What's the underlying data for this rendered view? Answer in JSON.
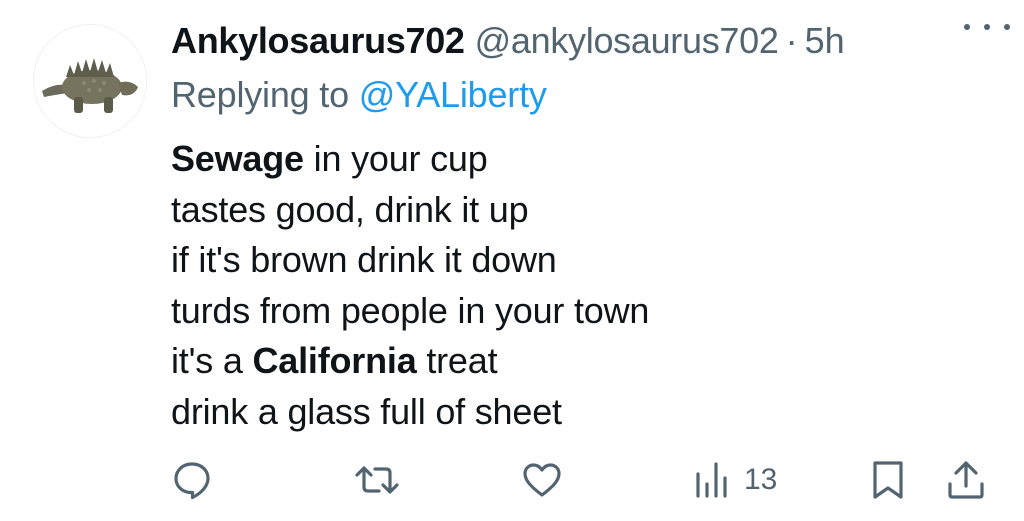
{
  "author": {
    "display_name": "Ankylosaurus702",
    "handle": "@ankylosaurus702",
    "separator": "·",
    "time": "5h"
  },
  "reply": {
    "prefix": "Replying to ",
    "mention": "@YALiberty"
  },
  "body": {
    "l1_bold": "Sewage",
    "l1_rest": " in your cup",
    "l2": "tastes good, drink it up",
    "l3": "if it's brown drink it down",
    "l4": "turds from people in your town",
    "l5_pre": "it's a ",
    "l5_bold": "California",
    "l5_post": " treat",
    "l6": "drink a glass full of sheet"
  },
  "actions": {
    "views_count": "13"
  },
  "icons": {
    "more": "more-icon",
    "reply": "reply-icon",
    "retweet": "retweet-icon",
    "like": "heart-icon",
    "views": "views-icon",
    "bookmark": "bookmark-icon",
    "share": "share-icon"
  },
  "colors": {
    "text": "#0f1419",
    "secondary": "#536471",
    "link": "#1d9bf0"
  }
}
